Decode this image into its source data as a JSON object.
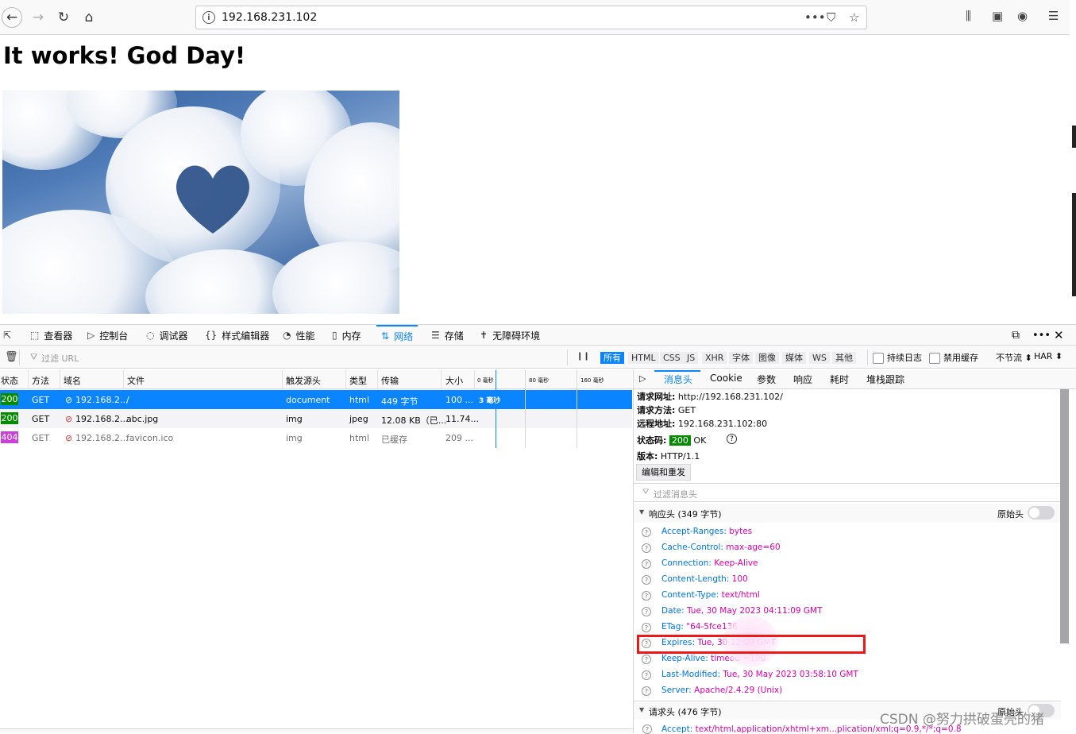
{
  "browser": {
    "url": "192.168.231.102",
    "url_more": "•••"
  },
  "page": {
    "heading": "It works! God Day!"
  },
  "devtools": {
    "tabs": [
      {
        "icon": "inspector-icon",
        "glyph": "⬚",
        "label": "查看器"
      },
      {
        "icon": "console-icon",
        "glyph": "▷",
        "label": "控制台"
      },
      {
        "icon": "debugger-icon",
        "glyph": "◌",
        "label": "调试器"
      },
      {
        "icon": "style-editor-icon",
        "glyph": "{}",
        "label": "样式编辑器"
      },
      {
        "icon": "performance-icon",
        "glyph": "◔",
        "label": "性能"
      },
      {
        "icon": "memory-icon",
        "glyph": "▯",
        "label": "内存"
      },
      {
        "icon": "network-icon",
        "glyph": "⇅",
        "label": "网络"
      },
      {
        "icon": "storage-icon",
        "glyph": "☰",
        "label": "存储"
      },
      {
        "icon": "accessibility-icon",
        "glyph": "✝",
        "label": "无障碍环境"
      }
    ],
    "filter_placeholder": "过滤 URL",
    "pause": "❙❙",
    "type_filters": [
      "所有",
      "HTML",
      "CSS",
      "JS",
      "XHR",
      "字体",
      "图像",
      "媒体",
      "WS",
      "其他"
    ],
    "persist_logs": "持续日志",
    "disable_cache": "禁用缓存",
    "throttle": "不节流 ⬍",
    "har": "HAR ⬍",
    "columns": [
      "状态",
      "方法",
      "域名",
      "文件",
      "触发源头",
      "类型",
      "传输",
      "大小"
    ],
    "waterfall_ticks": [
      "0 毫秒",
      "80 毫秒",
      "160 毫秒"
    ],
    "rows": [
      {
        "status": "200",
        "status_color": "#058b00",
        "method": "GET",
        "domain": "192.168.2...",
        "file": "/",
        "cause": "document",
        "type": "html",
        "transferred": "449 字节",
        "size": "100 ...",
        "timing": "3 毫秒"
      },
      {
        "status": "200",
        "status_color": "#058b00",
        "method": "GET",
        "domain": "192.168.2...",
        "file": "abc.jpg",
        "cause": "img",
        "type": "jpeg",
        "transferred": "12.08 KB（已...",
        "size": "11.74...",
        "timing": ""
      },
      {
        "status": "404",
        "status_color": "#c643d6",
        "method": "GET",
        "domain": "192.168.2...",
        "file": "favicon.ico",
        "cause": "img",
        "type": "html",
        "transferred": "已缓存",
        "size": "209 ...",
        "timing": ""
      }
    ],
    "side_tabs": [
      "消息头",
      "Cookie",
      "参数",
      "响应",
      "耗时",
      "堆栈跟踪"
    ],
    "summary": {
      "url_label": "请求网址:",
      "url": "http://192.168.231.102/",
      "method_label": "请求方法:",
      "method": "GET",
      "remote_label": "远程地址:",
      "remote": "192.168.231.102:80",
      "status_label": "状态码:",
      "status": "200",
      "status_text": "OK",
      "version_label": "版本:",
      "version": "HTTP/1.1"
    },
    "edit_resend": "编辑和重发",
    "filter_headers": "过滤消息头",
    "response_headers_title": "响应头 (349 字节)",
    "raw_headers": "原始头",
    "response_headers": [
      {
        "k": "Accept-Ranges:",
        "v": "bytes"
      },
      {
        "k": "Cache-Control:",
        "v": "max-age=60"
      },
      {
        "k": "Connection:",
        "v": "Keep-Alive"
      },
      {
        "k": "Content-Length:",
        "v": "100"
      },
      {
        "k": "Content-Type:",
        "v": "text/html"
      },
      {
        "k": "Date:",
        "v": "Tue, 30 May 2023 04:11:09 GMT"
      },
      {
        "k": "ETag:",
        "v": "\"64-5fce136"
      },
      {
        "k": "Expires:",
        "v": "Tue, 30                    12:09 GMT"
      },
      {
        "k": "Keep-Alive:",
        "v": "timeou              =100"
      },
      {
        "k": "Last-Modified:",
        "v": "Tue, 30 May 2023 03:58:10 GMT"
      },
      {
        "k": "Server:",
        "v": "Apache/2.4.29 (Unix)"
      }
    ],
    "request_headers_title": "请求头 (476 字节)",
    "request_first": {
      "k": "Accept:",
      "v": "text/html,application/xhtml+xm...plication/xml;q=0.9,*/*;q=0.8"
    }
  },
  "watermark": "CSDN @努力拱破蛋壳的猪"
}
